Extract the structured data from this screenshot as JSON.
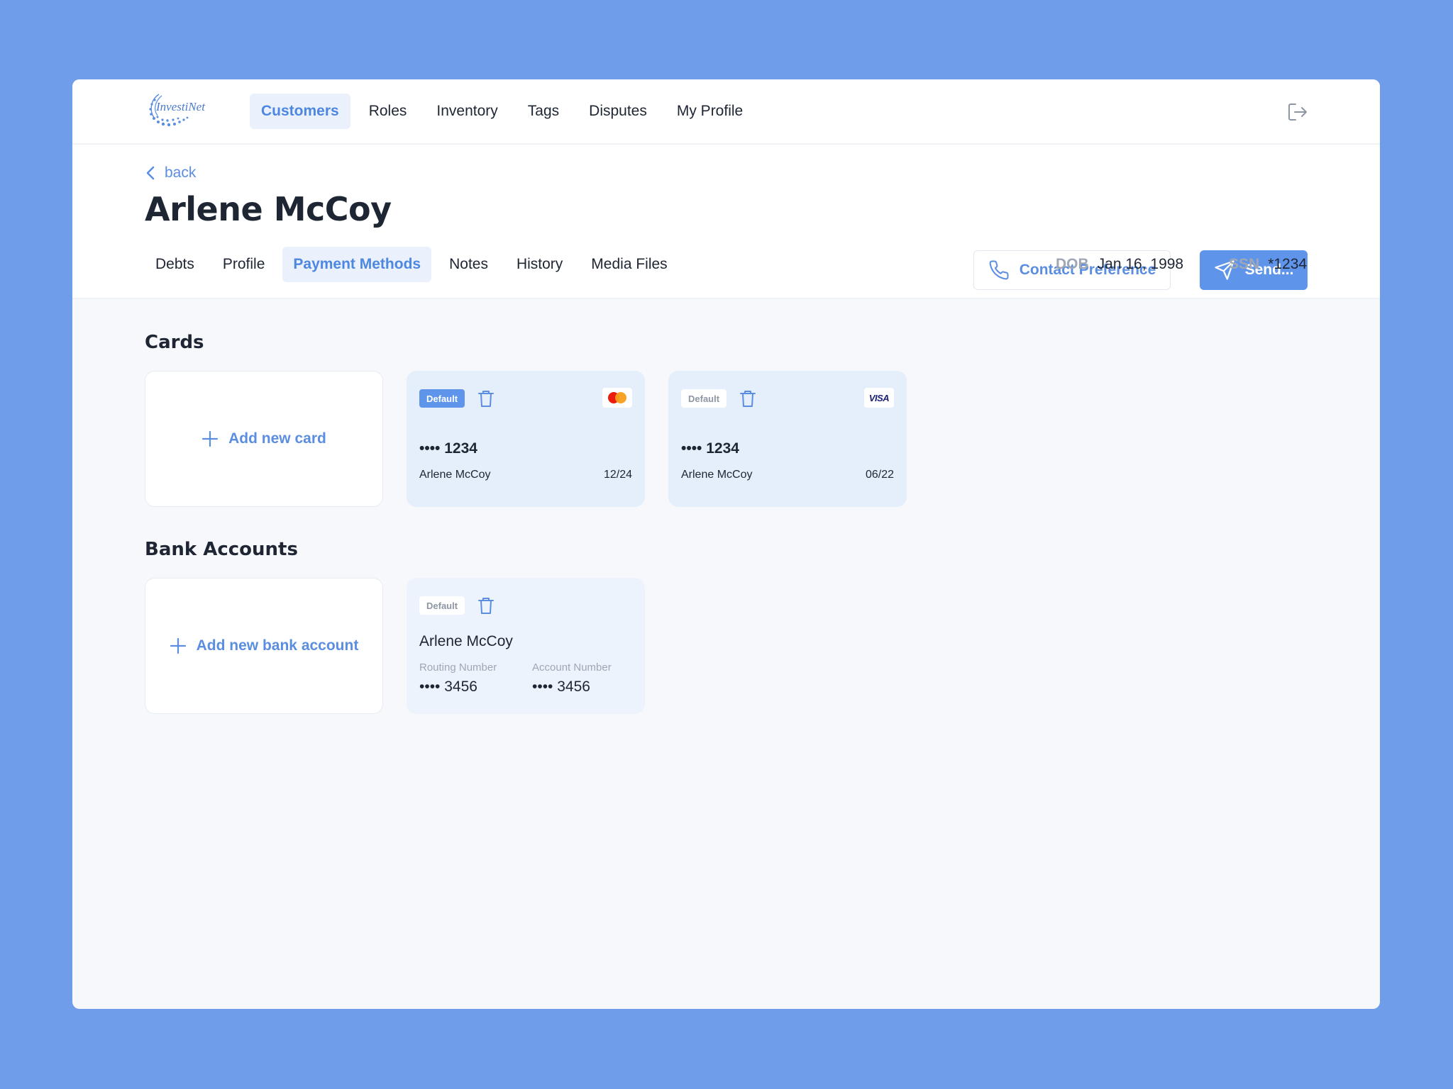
{
  "nav": {
    "logo_text": "InvestiNet",
    "items": [
      "Customers",
      "Roles",
      "Inventory",
      "Tags",
      "Disputes",
      "My Profile"
    ],
    "active": "Customers"
  },
  "header": {
    "back_label": "back",
    "title": "Arlene McCoy",
    "contact_button": "Contact Preference",
    "send_button": "Send...",
    "tabs": [
      "Debts",
      "Profile",
      "Payment Methods",
      "Notes",
      "History",
      "Media Files"
    ],
    "active_tab": "Payment Methods",
    "dob_label": "DOB",
    "dob_value": "Jan 16, 1998",
    "ssn_label": "SSN",
    "ssn_value": "*1234"
  },
  "cards_section": {
    "title": "Cards",
    "add_label": "Add new card",
    "cards": [
      {
        "badge": "Default",
        "is_default": true,
        "brand": "mastercard",
        "number": "•••• 1234",
        "holder": "Arlene McCoy",
        "expiry": "12/24"
      },
      {
        "badge": "Default",
        "is_default": false,
        "brand": "VISA",
        "number": "•••• 1234",
        "holder": "Arlene McCoy",
        "expiry": "06/22"
      }
    ]
  },
  "bank_section": {
    "title": "Bank Accounts",
    "add_label": "Add new bank account",
    "accounts": [
      {
        "badge": "Default",
        "is_default": false,
        "holder": "Arlene McCoy",
        "routing_label": "Routing Number",
        "routing_value": "•••• 3456",
        "account_label": "Account Number",
        "account_value": "•••• 3456"
      }
    ]
  },
  "colors": {
    "background": "#709DEA",
    "accent": "#5E95EA",
    "accent_text": "#4D87E0",
    "card_bg": "#E5EEFB"
  }
}
